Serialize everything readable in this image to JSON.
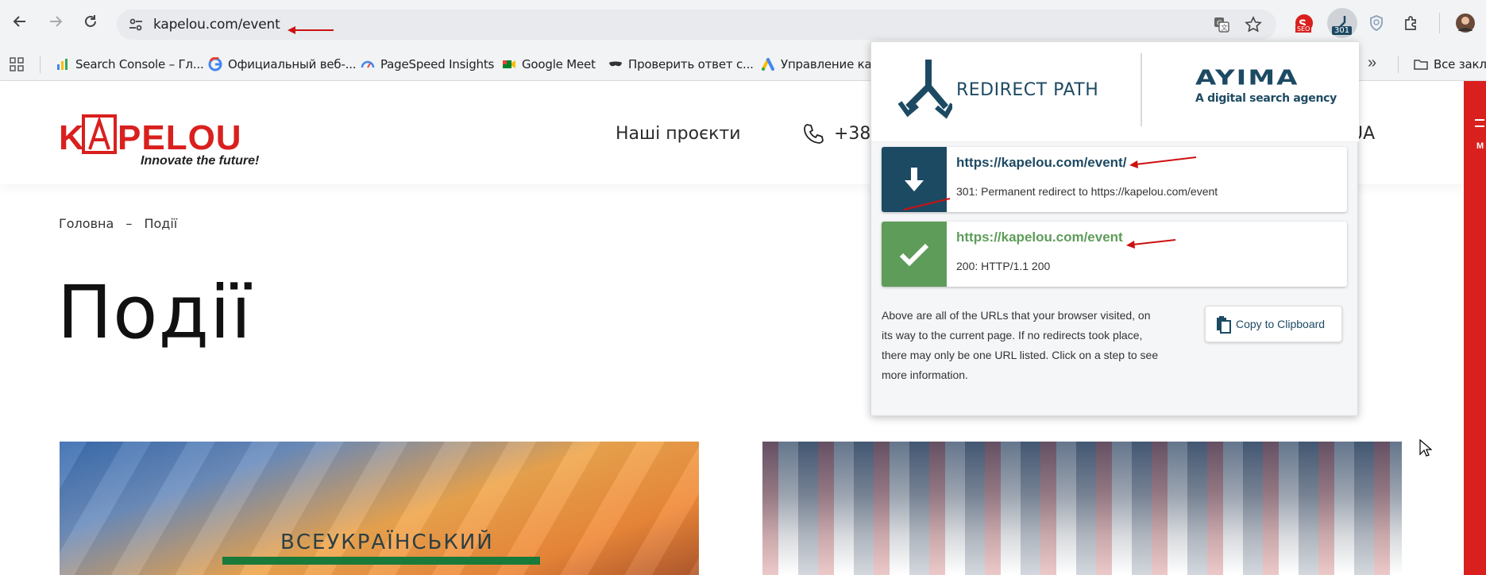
{
  "browser": {
    "url": "kapelou.com/event",
    "extension_badge": "301",
    "seo_badge": "SEO"
  },
  "bookmarks": [
    {
      "label": "Search Console – Гл...",
      "icon": "search-console-icon"
    },
    {
      "label": "Официальный веб-...",
      "icon": "google-icon"
    },
    {
      "label": "PageSpeed Insights",
      "icon": "pagespeed-icon"
    },
    {
      "label": "Google Meet",
      "icon": "meet-icon"
    },
    {
      "label": "Проверить ответ с...",
      "icon": "mask-icon"
    },
    {
      "label": "Управление кам",
      "icon": "google-ads-icon"
    }
  ],
  "bookmarks_more": "»",
  "bookmarks_all": "Все закл",
  "site": {
    "logo_text": "KAPELOU",
    "logo_tagline": "Innovate the future!",
    "nav_projects": "Наші проєкти",
    "phone": "+38 (",
    "lang": "UA",
    "side_label": "М",
    "breadcrumb": [
      "Головна",
      "–",
      "Події"
    ],
    "title": "Події",
    "card1_text": "ВСЕУКРАЇНСЬКИЙ"
  },
  "popup": {
    "brand": "REDIRECT PATH",
    "partner": "AYIMA",
    "partner_tagline": "A digital search agency",
    "steps": [
      {
        "url": "https://kapelou.com/event/",
        "status": "301: Permanent redirect to https://kapelou.com/event",
        "icon": "down-arrow-icon"
      },
      {
        "url": "https://kapelou.com/event",
        "status": "200: HTTP/1.1 200",
        "icon": "checkmark-icon"
      }
    ],
    "info": "Above are all of the URLs that your browser visited, on its way to the current page. If no redirects took place, there may only be one URL listed. Click on a step to see more information.",
    "copy_button": "Copy to Clipboard"
  },
  "colors": {
    "brand_red": "#d9201e",
    "redirect_blue": "#1d4a63",
    "success_green": "#5e9c5a",
    "annotation_red": "#cc1111"
  }
}
